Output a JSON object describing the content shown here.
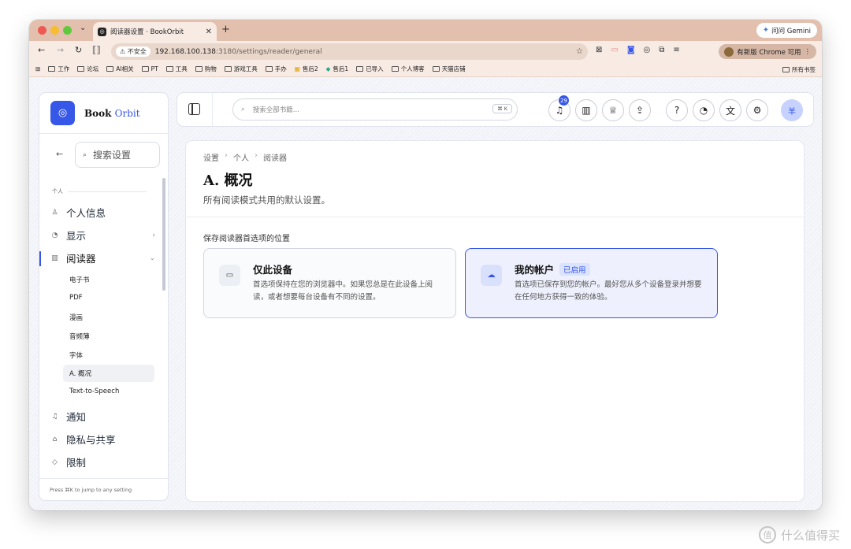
{
  "browser": {
    "tab_title": "阅读器设置 · BookOrbit",
    "gemini_label": "问问 Gemini",
    "insecure_label": "不安全",
    "url_host": "192.168.100.138",
    "url_rest": ":3180/settings/reader/general",
    "update_label": "有新版 Chrome 可用",
    "bookmarks": [
      "工作",
      "论坛",
      "AI相关",
      "PT",
      "工具",
      "购物",
      "游戏工具",
      "手办",
      "售后2",
      "售后1",
      "已导入",
      "个人博客",
      "天猫店铺"
    ],
    "all_bookmarks": "所有书签"
  },
  "sidebar": {
    "brand_book": "Book",
    "brand_orbit": "Orbit",
    "search_placeholder": "搜索设置",
    "section_label": "个人",
    "items": [
      {
        "label": "个人信息",
        "icon": "user-icon"
      },
      {
        "label": "显示",
        "icon": "palette-icon"
      },
      {
        "label": "阅读器",
        "icon": "book-icon"
      }
    ],
    "sub_items": [
      "电子书",
      "PDF",
      "漫画",
      "音频薄",
      "字体",
      "A. 概况",
      "Text-to-Speech"
    ],
    "items_bottom": [
      {
        "label": "通知",
        "icon": "bell-icon"
      },
      {
        "label": "隐私与共享",
        "icon": "lock-icon"
      },
      {
        "label": "限制",
        "icon": "shield-icon"
      }
    ],
    "footer": "Press ⌘K to jump to any setting"
  },
  "topbar": {
    "search_placeholder": "搜索全部书籍...",
    "shortcut": "⌘ K",
    "notification_count": "29",
    "avatar_initial": "羊"
  },
  "main": {
    "breadcrumb": [
      "设置",
      "个人",
      "阅读器"
    ],
    "title": "A. 概况",
    "subtitle": "所有阅读模式共用的默认设置。",
    "section_label": "保存阅读器首选项的位置",
    "cards": [
      {
        "title": "仅此设备",
        "desc": "首选项保持在您的浏览器中。如果您总是在此设备上阅读，或者想要每台设备有不同的设置。",
        "selected": false
      },
      {
        "title": "我的帐户",
        "tag": "已启用",
        "desc": "首选项已保存到您的帐户。最好您从多个设备登录并想要在任何地方获得一致的体验。",
        "selected": true
      }
    ]
  },
  "watermark": "什么值得买",
  "colors": {
    "accent": "#3657e8",
    "tabstrip": "#e3bfad"
  }
}
